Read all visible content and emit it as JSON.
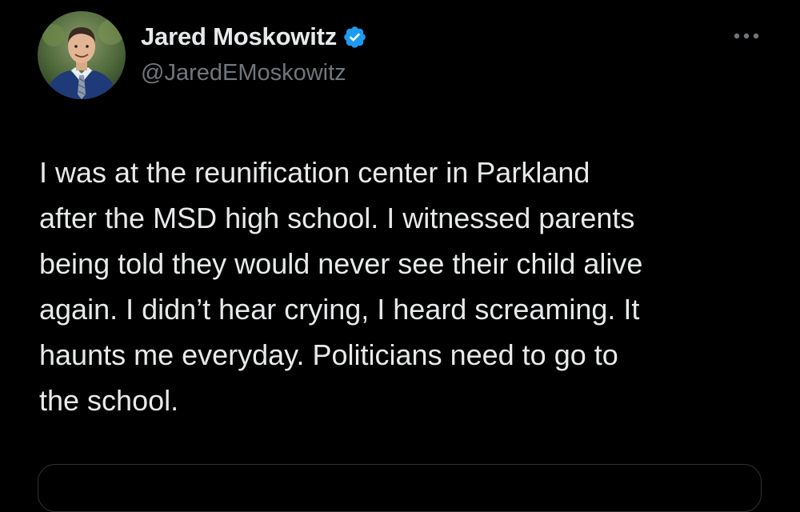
{
  "author": {
    "display_name": "Jared Moskowitz",
    "handle": "@JaredEMoskowitz",
    "verified": true,
    "avatar_icon": "profile-photo"
  },
  "tweet": {
    "text": "I was at the reunification center in Parkland\nafter the MSD high school. I witnessed parents\nbeing told they would never see their child alive\nagain. I didn’t hear crying, I heard screaming. It\nhaunts me everyday. Politicians need to go to\nthe school."
  },
  "colors": {
    "background": "#000000",
    "primary_text": "#e7e9ea",
    "secondary_text": "#71767b",
    "verified_blue": "#1d9bf0",
    "border": "#2f3336"
  },
  "icons": {
    "more": "more-horizontal-icon",
    "verified": "verified-badge-icon"
  }
}
